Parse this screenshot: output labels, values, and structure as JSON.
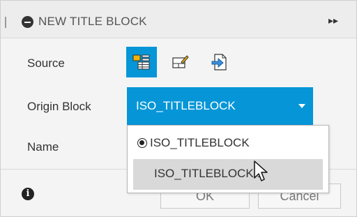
{
  "header": {
    "title": "NEW TITLE BLOCK"
  },
  "labels": {
    "source": "Source",
    "origin_block": "Origin Block",
    "name": "Name"
  },
  "source_icons": [
    {
      "name": "browser-table-icon",
      "active": true
    },
    {
      "name": "sheet-edit-icon",
      "active": false
    },
    {
      "name": "import-file-icon",
      "active": false
    }
  ],
  "origin_block": {
    "selected": "ISO_TITLEBLOCK"
  },
  "dropdown_options": [
    {
      "label": "ISO_TITLEBLOCK",
      "checked": true
    },
    {
      "label": "ISO_TITLEBLOCK 1",
      "checked": false
    }
  ],
  "buttons": {
    "ok": "OK",
    "cancel": "Cancel"
  },
  "colors": {
    "accent": "#0696d7",
    "hover": "#d9d9d9"
  }
}
